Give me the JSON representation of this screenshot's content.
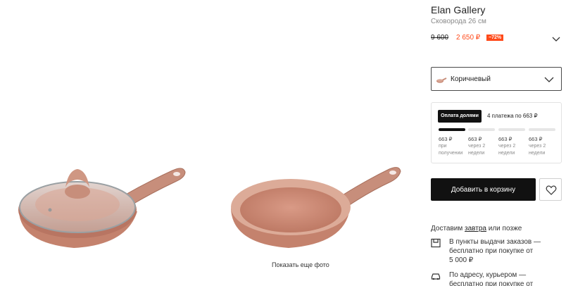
{
  "gallery": {
    "show_more_label": "Показать еще фото",
    "photos": [
      {
        "alt": "Сковорода с крышкой"
      },
      {
        "alt": "Сковорода без крышки"
      }
    ]
  },
  "product": {
    "brand": "Elan Gallery",
    "title": "Сковорода 26 см",
    "old_price": "9 600",
    "new_price": "2 650 ₽",
    "discount": "−72%",
    "accent_color": "#ff4a1a"
  },
  "color_select": {
    "selected": "Коричневый",
    "icon": "chevron-down-icon"
  },
  "split_payment": {
    "badge": "Оплата долями",
    "summary": "4 платежа по 663 ₽",
    "installments": [
      {
        "amount": "663 ₽",
        "when_1": "при",
        "when_2": "получении",
        "active": true
      },
      {
        "amount": "663 ₽",
        "when_1": "через 2",
        "when_2": "недели",
        "active": false
      },
      {
        "amount": "663 ₽",
        "when_1": "через 2",
        "when_2": "недели",
        "active": false
      },
      {
        "amount": "663 ₽",
        "when_1": "через 2",
        "when_2": "недели",
        "active": false
      }
    ]
  },
  "actions": {
    "add_to_cart": "Добавить в корзину",
    "favorite_icon": "heart-icon"
  },
  "delivery": {
    "head_prefix": "Доставим",
    "head_link": "завтра",
    "head_suffix": "или позже",
    "items": [
      {
        "icon": "pickup-point-icon",
        "line1": "В пункты выдачи заказов —",
        "line2": "бесплатно при покупке от",
        "line3": "5 000 ₽"
      },
      {
        "icon": "car-icon",
        "line1": "По адресу, курьером —",
        "line2": "бесплатно при покупке от"
      }
    ]
  }
}
